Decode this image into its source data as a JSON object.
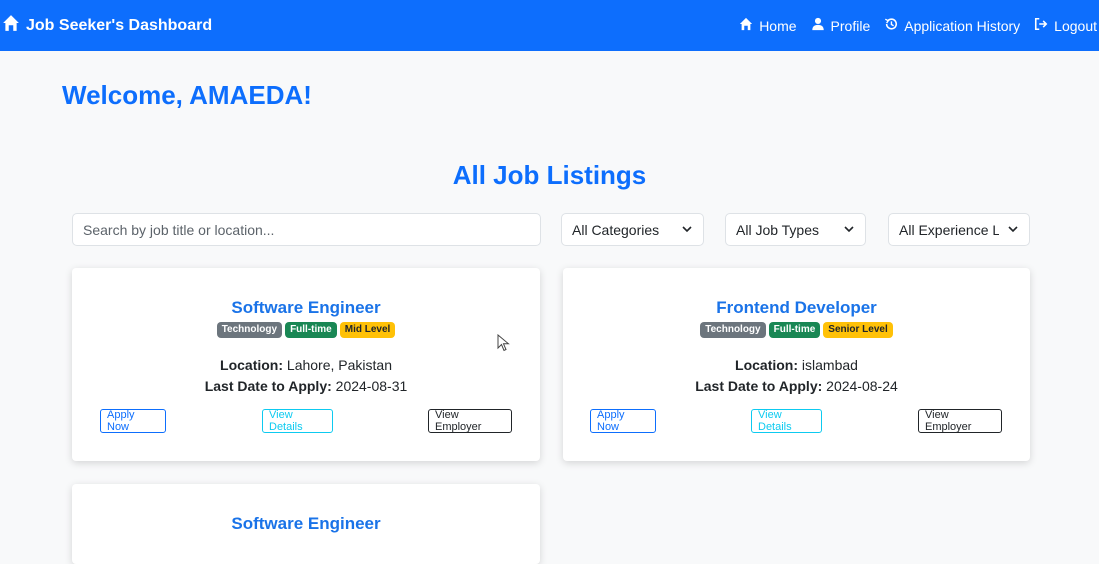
{
  "navbar": {
    "brand": "Job Seeker's Dashboard",
    "links": [
      {
        "label": "Home",
        "icon": "home-icon"
      },
      {
        "label": "Profile",
        "icon": "user-icon"
      },
      {
        "label": "Application History",
        "icon": "history-icon"
      },
      {
        "label": "Logout",
        "icon": "logout-icon"
      }
    ]
  },
  "welcome": "Welcome, AMAEDA!",
  "section_title": "All Job Listings",
  "filters": {
    "search_placeholder": "Search by job title or location...",
    "category": "All Categories",
    "job_type": "All Job Types",
    "experience": "All Experience Levels"
  },
  "labels": {
    "location": "Location:",
    "last_date": "Last Date to Apply:",
    "apply": "Apply Now",
    "details": "View Details",
    "employer": "View Employer"
  },
  "jobs": [
    {
      "title": "Software Engineer",
      "category": "Technology",
      "type": "Full-time",
      "level": "Mid Level",
      "location": "Lahore, Pakistan",
      "last_date": "2024-08-31"
    },
    {
      "title": "Frontend Developer",
      "category": "Technology",
      "type": "Full-time",
      "level": "Senior Level",
      "location": "islambad",
      "last_date": "2024-08-24"
    },
    {
      "title": "Software Engineer"
    }
  ],
  "colors": {
    "primary": "#0d6efd",
    "category_badge": "#6c757d",
    "type_badge": "#198754",
    "level_badge": "#ffc107"
  }
}
